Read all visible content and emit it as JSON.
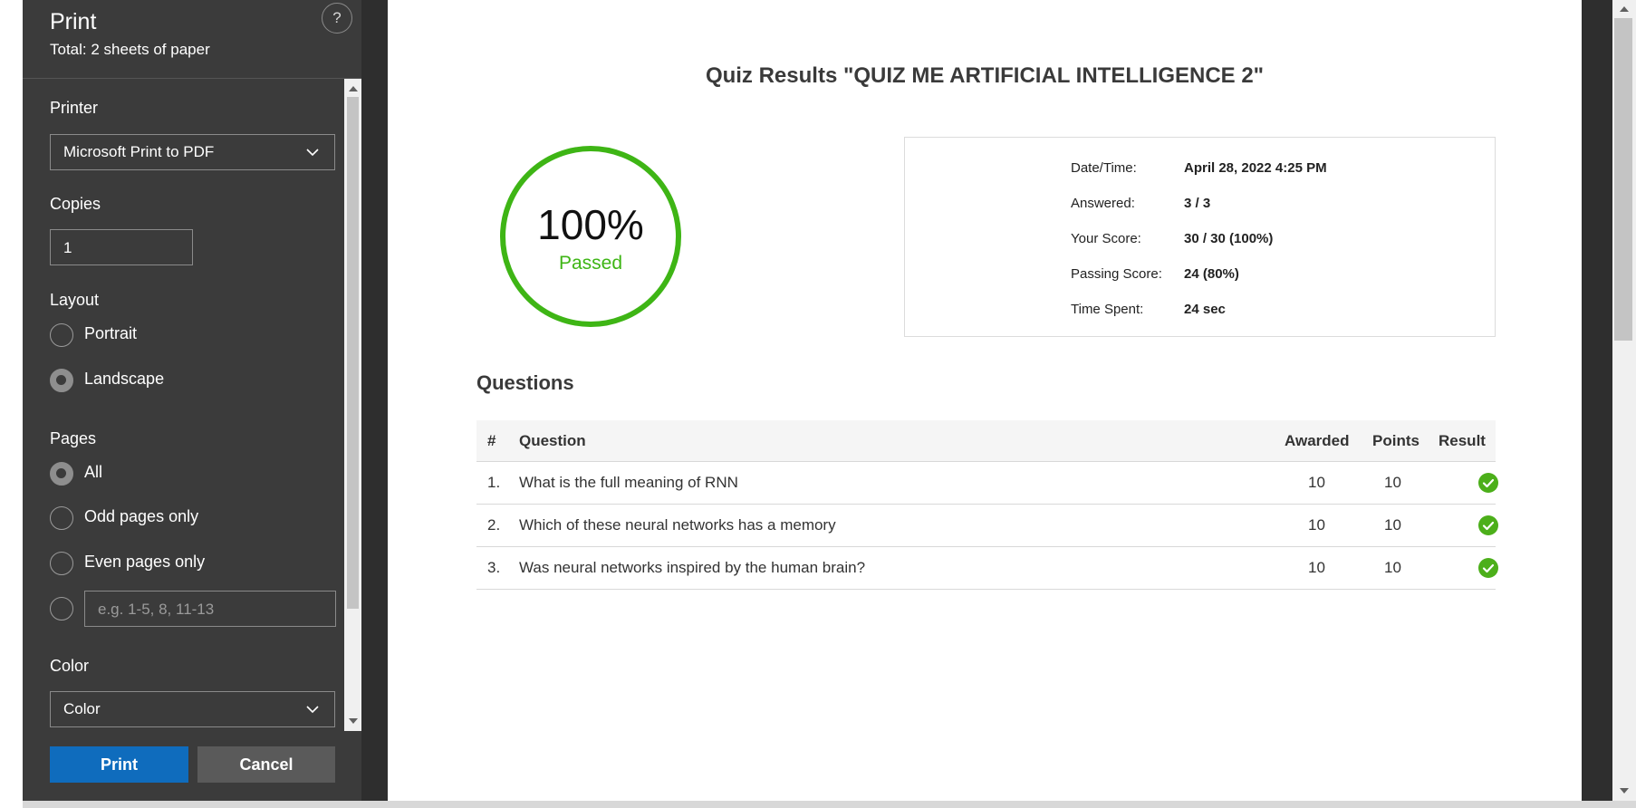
{
  "print_panel": {
    "title": "Print",
    "subtitle": "Total: 2 sheets of paper",
    "help_label": "?",
    "printer": {
      "label": "Printer",
      "value": "Microsoft Print to PDF"
    },
    "copies": {
      "label": "Copies",
      "value": "1"
    },
    "layout": {
      "label": "Layout",
      "options": [
        "Portrait",
        "Landscape"
      ],
      "selected": "Landscape"
    },
    "pages": {
      "label": "Pages",
      "options": [
        "All",
        "Odd pages only",
        "Even pages only"
      ],
      "selected": "All",
      "custom_placeholder": "e.g. 1-5, 8, 11-13"
    },
    "color": {
      "label": "Color",
      "value": "Color"
    },
    "print_button": "Print",
    "cancel_button": "Cancel",
    "accent_color": "#0f6cbd"
  },
  "quiz": {
    "title": "Quiz Results \"QUIZ ME ARTIFICIAL INTELLIGENCE 2\"",
    "score_percent": "100%",
    "status": "Passed",
    "status_color": "#3eb515",
    "info": [
      {
        "label": "Date/Time:",
        "value": "April 28, 2022 4:25 PM"
      },
      {
        "label": "Answered:",
        "value": "3 / 3"
      },
      {
        "label": "Your Score:",
        "value": "30 / 30 (100%)"
      },
      {
        "label": "Passing Score:",
        "value": "24 (80%)"
      },
      {
        "label": "Time Spent:",
        "value": "24 sec"
      }
    ],
    "questions_heading": "Questions",
    "table": {
      "headers": [
        "#",
        "Question",
        "Awarded",
        "Points",
        "Result"
      ],
      "rows": [
        {
          "num": "1.",
          "question": "What is the full meaning of RNN",
          "awarded": "10",
          "points": "10",
          "result": "check-icon"
        },
        {
          "num": "2.",
          "question": "Which of these neural networks has a memory",
          "awarded": "10",
          "points": "10",
          "result": "check-icon"
        },
        {
          "num": "3.",
          "question": "Was neural networks inspired by the human brain?",
          "awarded": "10",
          "points": "10",
          "result": "check-icon"
        }
      ]
    }
  }
}
